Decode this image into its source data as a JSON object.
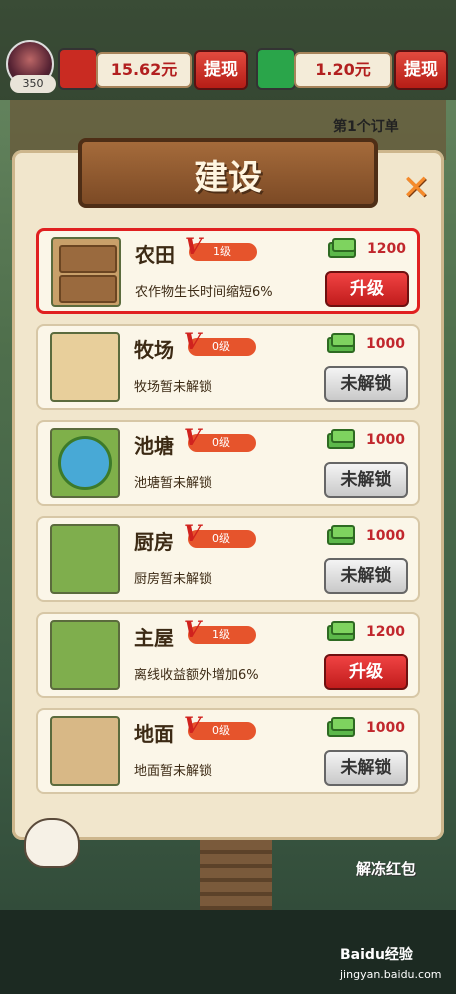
{
  "hud": {
    "player_level": "350",
    "red_packet_balance": "15.62元",
    "wechat_balance": "1.20元",
    "withdraw_label_1": "提现",
    "withdraw_label_2": "提现"
  },
  "order": {
    "label": "第1个订单"
  },
  "panel": {
    "title": "建设",
    "items": [
      {
        "name": "农田",
        "level": "1级",
        "cost": "1200",
        "desc": "农作物生长时间缩短6%",
        "action": "升级",
        "locked": false
      },
      {
        "name": "牧场",
        "level": "0级",
        "cost": "1000",
        "desc": "牧场暂未解锁",
        "action": "未解锁",
        "locked": true
      },
      {
        "name": "池塘",
        "level": "0级",
        "cost": "1000",
        "desc": "池塘暂未解锁",
        "action": "未解锁",
        "locked": true
      },
      {
        "name": "厨房",
        "level": "0级",
        "cost": "1000",
        "desc": "厨房暂未解锁",
        "action": "未解锁",
        "locked": true
      },
      {
        "name": "主屋",
        "level": "1级",
        "cost": "1200",
        "desc": "离线收益额外增加6%",
        "action": "升级",
        "locked": false
      },
      {
        "name": "地面",
        "level": "0级",
        "cost": "1000",
        "desc": "地面暂未解锁",
        "action": "未解锁",
        "locked": true
      }
    ]
  },
  "bottom": {
    "unfreeze_label": "解冻红包"
  },
  "watermark": {
    "brand": "Baidu经验",
    "url": "jingyan.baidu.com"
  },
  "colors": {
    "accent_red": "#c1272d",
    "panel_bg": "#f1e6cc",
    "highlight": "#e02020"
  }
}
